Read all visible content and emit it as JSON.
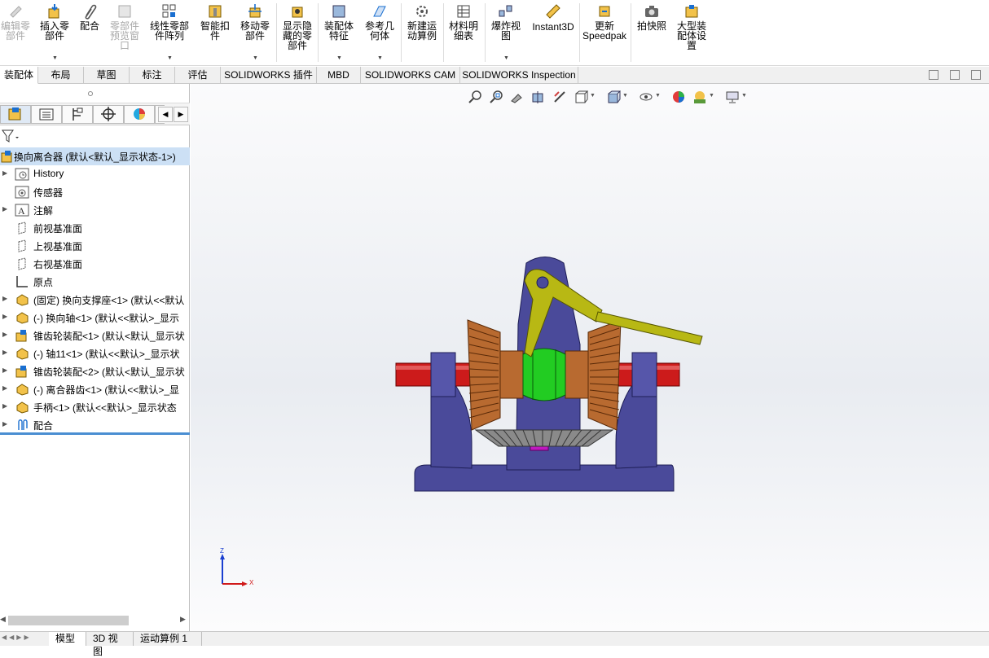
{
  "ribbon": {
    "edit_component": "编辑零\n部件",
    "insert_component": "插入零\n部件",
    "mate": "配合",
    "component_preview": "零部件\n预览窗\n口",
    "linear_pattern": "线性零部\n件阵列",
    "smart_fasteners": "智能扣\n件",
    "move_component": "移动零\n部件",
    "show_hidden": "显示隐\n藏的零\n部件",
    "assembly_features": "装配体\n特征",
    "reference_geometry": "参考几\n何体",
    "new_motion_study": "新建运\n动算例",
    "bom": "材料明\n细表",
    "exploded_view": "爆炸视\n图",
    "instant3d": "Instant3D",
    "update_speedpak": "更新\nSpeedpak",
    "snapshot": "拍快照",
    "large_assembly": "大型装\n配体设\n置"
  },
  "tabs": [
    "装配体",
    "布局",
    "草图",
    "标注",
    "评估",
    "SOLIDWORKS 插件",
    "MBD",
    "SOLIDWORKS CAM",
    "SOLIDWORKS Inspection"
  ],
  "tree": {
    "root": "换向离合器 (默认<默认_显示状态-1>)",
    "items": [
      "History",
      "传感器",
      "注解",
      "前视基准面",
      "上视基准面",
      "右视基准面",
      "原点",
      "(固定) 换向支撑座<1> (默认<<默认",
      "(-) 换向轴<1> (默认<<默认>_显示",
      "锥齿轮装配<1> (默认<默认_显示状",
      "(-) 轴11<1> (默认<<默认>_显示状",
      "锥齿轮装配<2> (默认<默认_显示状",
      "(-) 离合器齿<1> (默认<<默认>_显",
      "手柄<1> (默认<<默认>_显示状态",
      "配合"
    ]
  },
  "triad": {
    "z": "Z",
    "x": "X"
  },
  "bottom_tabs": [
    "模型",
    "3D 视图",
    "运动算例 1"
  ],
  "colors": {
    "base": "#4a4a9a",
    "shaft": "#cc1b1b",
    "gear": "#b86a30",
    "handle": "#b8b814",
    "clutch": "#22cc22"
  }
}
